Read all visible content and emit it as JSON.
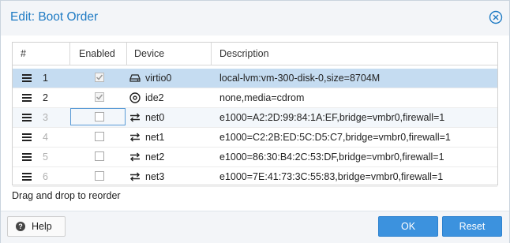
{
  "dialog": {
    "title": "Edit: Boot Order",
    "columns": {
      "num": "#",
      "enabled": "Enabled",
      "device": "Device",
      "description": "Description"
    },
    "rows": [
      {
        "num": "1",
        "enabled": true,
        "device": "virtio0",
        "device_icon": "hdd-icon",
        "description": "local-lvm:vm-300-disk-0,size=8704M",
        "selected": true
      },
      {
        "num": "2",
        "enabled": true,
        "device": "ide2",
        "device_icon": "cdrom-icon",
        "description": "none,media=cdrom"
      },
      {
        "num": "3",
        "enabled": false,
        "device": "net0",
        "device_icon": "network-icon",
        "description": "e1000=A2:2D:99:84:1A:EF,bridge=vmbr0,firewall=1"
      },
      {
        "num": "4",
        "enabled": false,
        "device": "net1",
        "device_icon": "network-icon",
        "description": "e1000=C2:2B:ED:5C:D5:C7,bridge=vmbr0,firewall=1"
      },
      {
        "num": "5",
        "enabled": false,
        "device": "net2",
        "device_icon": "network-icon",
        "description": "e1000=86:30:B4:2C:53:DF,bridge=vmbr0,firewall=1"
      },
      {
        "num": "6",
        "enabled": false,
        "device": "net3",
        "device_icon": "network-icon",
        "description": "e1000=7E:41:73:3C:55:83,bridge=vmbr0,firewall=1"
      }
    ],
    "hint": "Drag and drop to reorder",
    "buttons": {
      "help": "Help",
      "ok": "OK",
      "reset": "Reset"
    },
    "colors": {
      "accent": "#3c92de",
      "title": "#1f7bc4",
      "selected_row": "#c5dcf1"
    }
  }
}
